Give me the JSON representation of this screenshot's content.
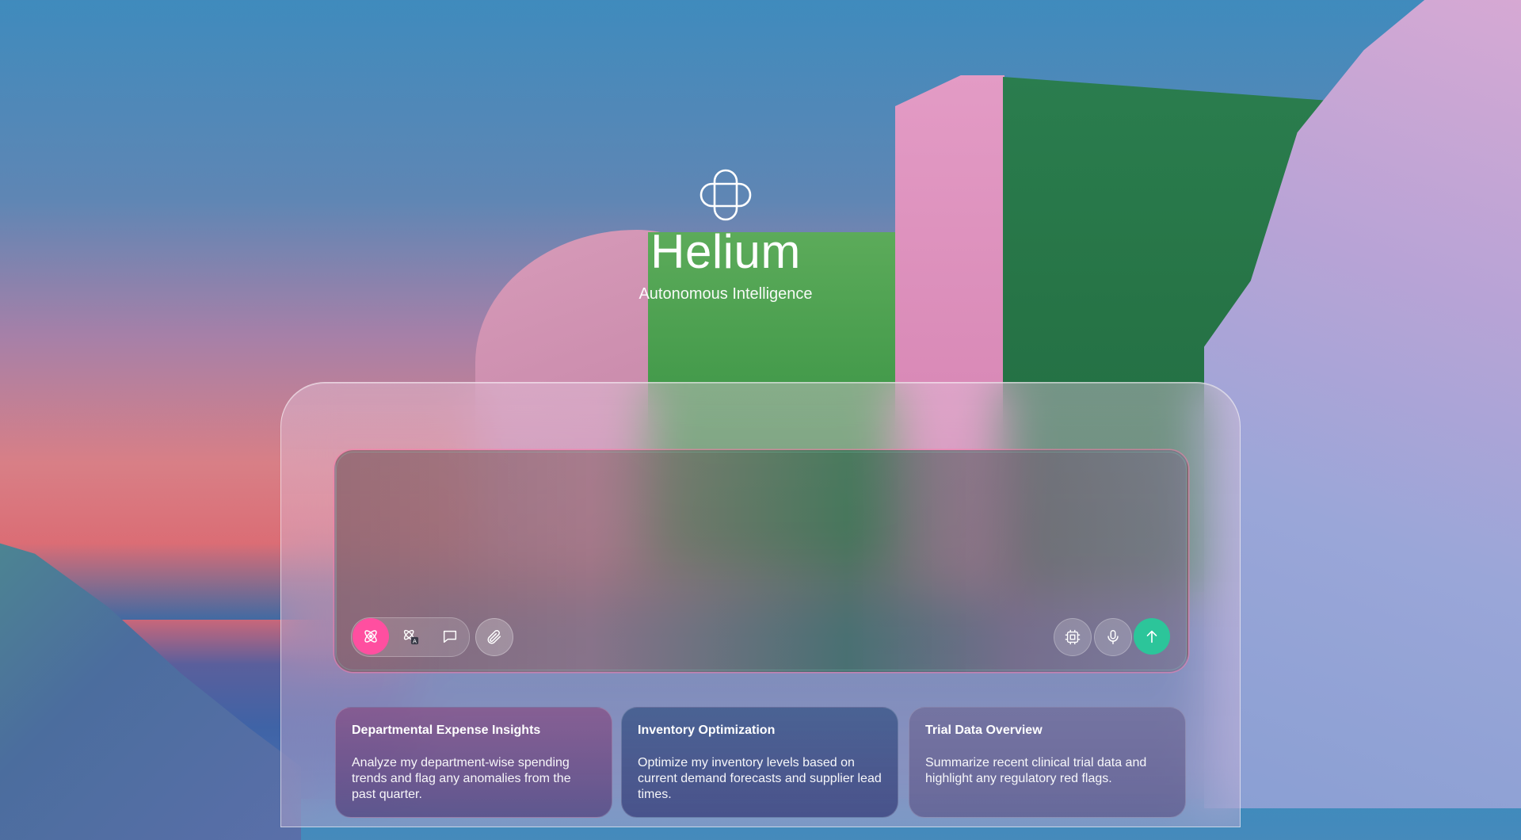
{
  "brand": {
    "logo_icon": "four-petal-loop-icon",
    "title": "Helium",
    "subtitle": "Autonomous Intelligence"
  },
  "composer": {
    "placeholder": "",
    "mode_buttons": [
      {
        "icon": "atom-icon",
        "active": true
      },
      {
        "icon": "translate-atom-icon",
        "active": false
      },
      {
        "icon": "chat-bubble-icon",
        "active": false
      }
    ],
    "attach_icon": "paperclip-icon",
    "right_buttons": [
      {
        "icon": "chip-icon"
      },
      {
        "icon": "microphone-icon"
      },
      {
        "icon": "arrow-up-icon"
      }
    ],
    "accent_active": "#ff4fa0",
    "accent_send": "#2cc59a"
  },
  "suggestions": [
    {
      "title": "Departmental Expense Insights",
      "description": "Analyze my department-wise spending trends and flag any anomalies from the past quarter."
    },
    {
      "title": "Inventory Optimization",
      "description": "Optimize my inventory levels based on current demand forecasts and supplier lead times."
    },
    {
      "title": "Trial Data Overview",
      "description": "Summarize recent clinical trial data and highlight any regulatory red flags."
    }
  ]
}
